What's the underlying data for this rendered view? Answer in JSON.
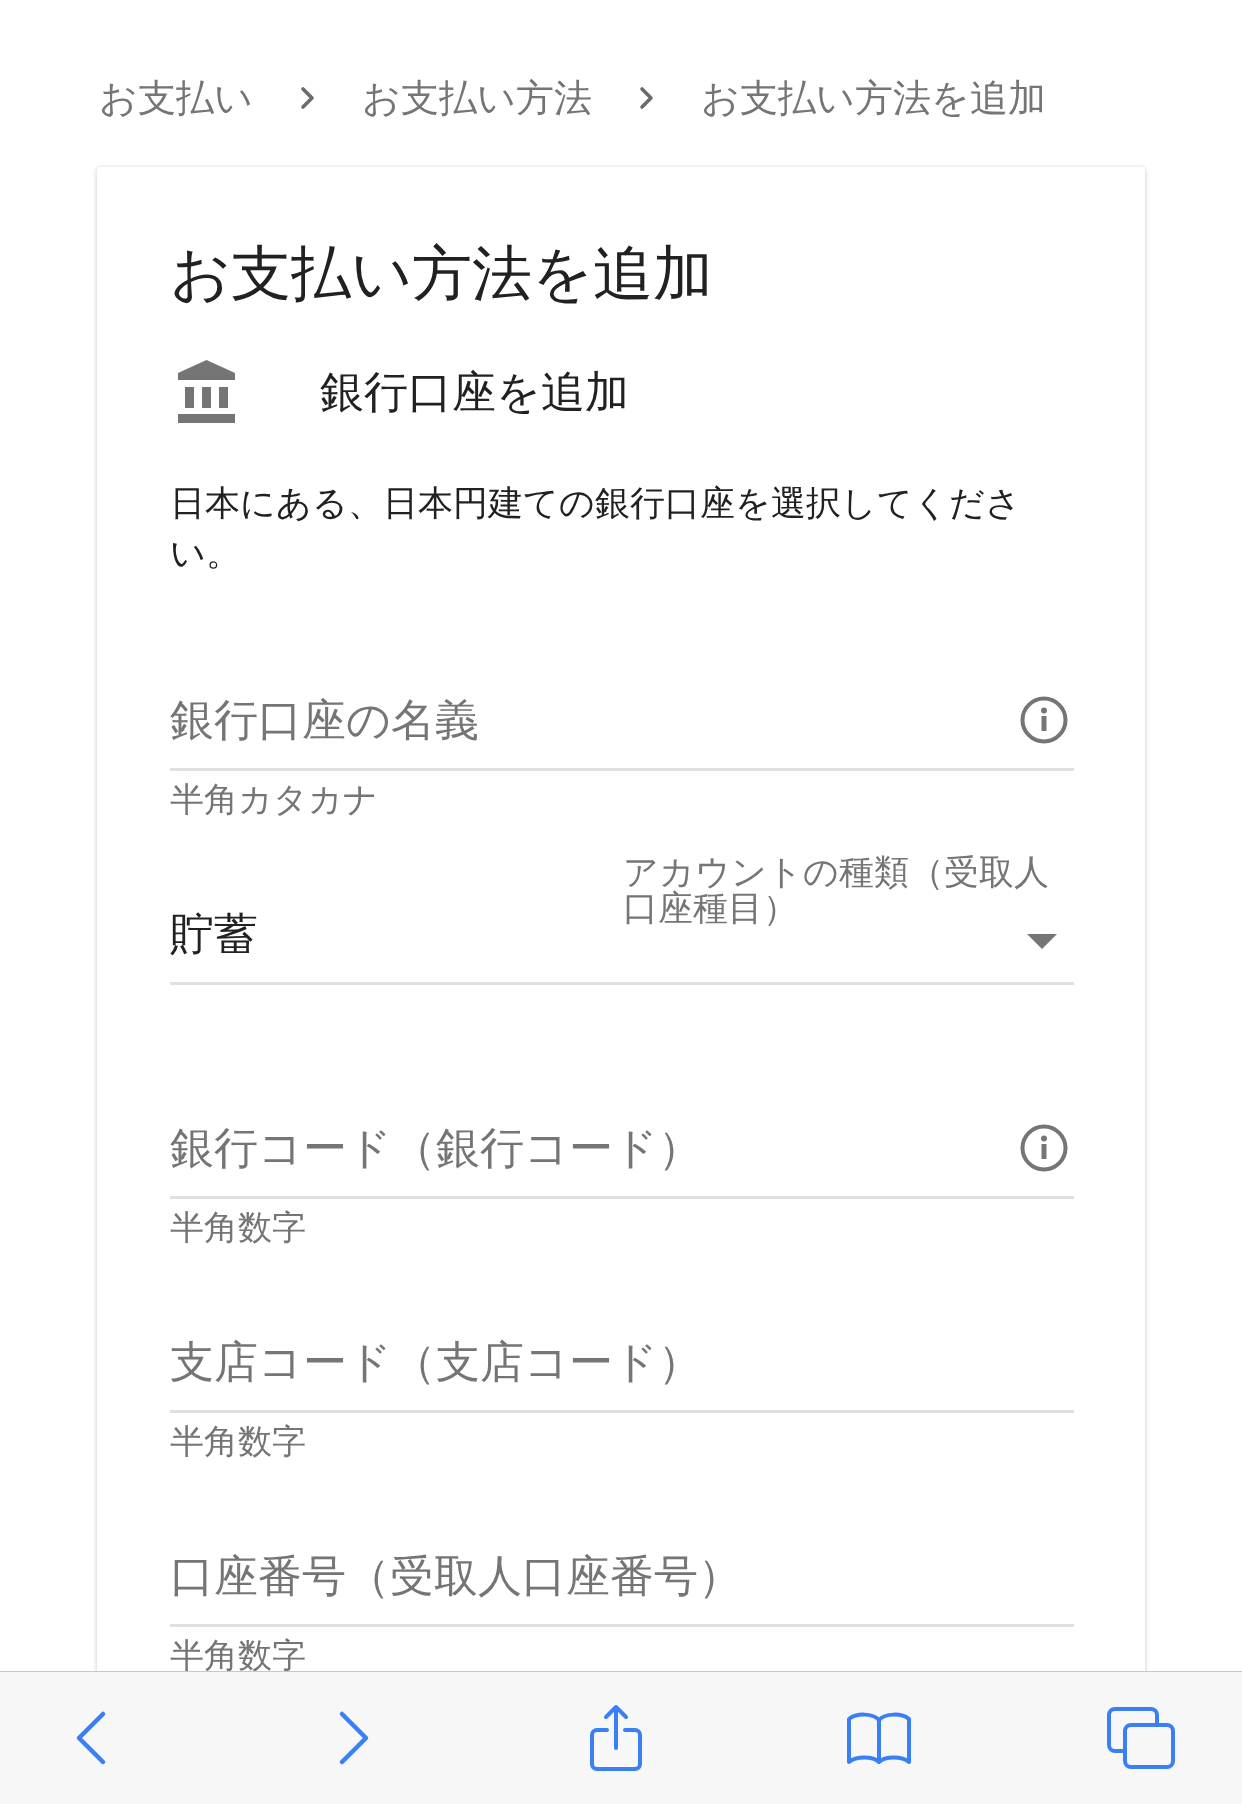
{
  "breadcrumb": [
    {
      "label": "お支払い"
    },
    {
      "label": "お支払い方法"
    },
    {
      "label": "お支払い方法を追加"
    }
  ],
  "card": {
    "title": "お支払い方法を追加",
    "section": {
      "title": "銀行口座を追加"
    },
    "description": "日本にある、日本円建ての銀行口座を選択してください。",
    "fields": [
      {
        "kind": "text",
        "label": "銀行口座の名義",
        "helper": "半角カタカナ",
        "info": true
      },
      {
        "kind": "select",
        "label": "アカウントの種類（受取人口座種目）",
        "value": "貯蓄"
      },
      {
        "kind": "text",
        "label": "銀行コード（銀行コード）",
        "helper": "半角数字",
        "info": true
      },
      {
        "kind": "text",
        "label": "支店コード（支店コード）",
        "helper": "半角数字",
        "info": false
      },
      {
        "kind": "text",
        "label": "口座番号（受取人口座番号）",
        "helper": "半角数字",
        "info": false
      }
    ]
  }
}
